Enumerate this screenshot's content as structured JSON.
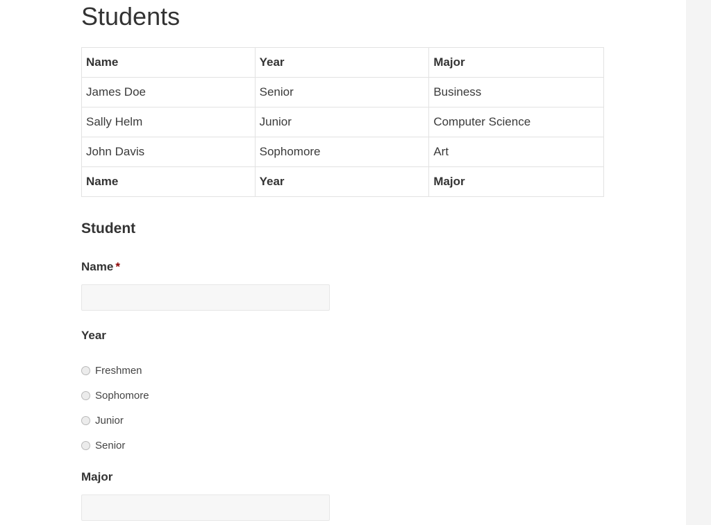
{
  "page": {
    "title": "Students"
  },
  "table": {
    "header": [
      "Name",
      "Year",
      "Major"
    ],
    "rows": [
      [
        "James Doe",
        "Senior",
        "Business"
      ],
      [
        "Sally Helm",
        "Junior",
        "Computer Science"
      ],
      [
        "John Davis",
        "Sophomore",
        "Art"
      ]
    ],
    "footer": [
      "Name",
      "Year",
      "Major"
    ]
  },
  "form": {
    "title": "Student",
    "name_label": "Name",
    "required_mark": "*",
    "name_value": "",
    "year_label": "Year",
    "year_options": [
      "Freshmen",
      "Sophomore",
      "Junior",
      "Senior"
    ],
    "major_label": "Major",
    "major_value": ""
  }
}
